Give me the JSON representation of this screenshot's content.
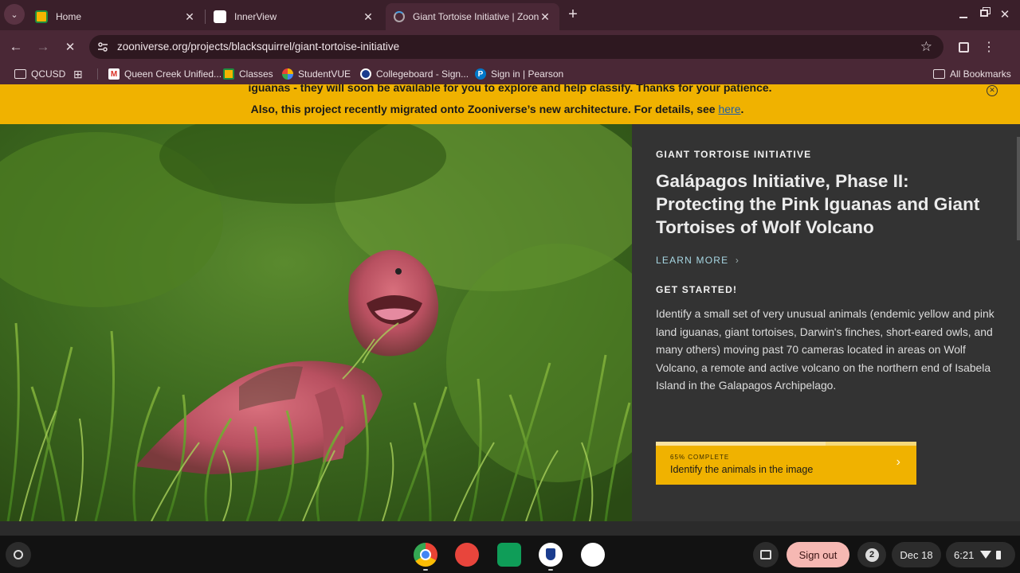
{
  "tabs": [
    {
      "title": "Home",
      "active": false
    },
    {
      "title": "InnerView",
      "active": false
    },
    {
      "title": "Giant Tortoise Initiative | Zooniverse",
      "active": true
    }
  ],
  "toolbar": {
    "url": "zooniverse.org/projects/blacksquirrel/giant-tortoise-initiative"
  },
  "bookmarks": {
    "items": [
      "QCUSD",
      "Queen Creek Unified...",
      "Classes",
      "StudentVUE",
      "Collegeboard - Sign...",
      "Sign in | Pearson"
    ],
    "all_label": "All Bookmarks"
  },
  "banner": {
    "line1": "iguanas - they will soon be available for you to explore and help classify. Thanks for your patience.",
    "line2": "Also, this project recently migrated onto Zooniverse’s new architecture. For details, see ",
    "link": "here",
    "period": "."
  },
  "hero": {
    "kicker": "GIANT TORTOISE INITIATIVE",
    "title": "Galápagos Initiative, Phase II: Protecting the Pink Iguanas and Giant Tortoises of Wolf Volcano",
    "learn_more": "LEARN MORE",
    "get_started": "GET STARTED!",
    "description": "Identify a small set of very unusual animals (endemic yellow and pink land iguanas, giant tortoises, Darwin's finches, short-eared owls, and many others) moving past 70 cameras located in areas on Wolf Volcano, a remote and active volcano on the northern end of Isabela Island in the Galapagos Archipelago.",
    "workflow": {
      "progress_label": "65% COMPLETE",
      "progress": 0.65,
      "label": "Identify the animals in the image"
    }
  },
  "shelf": {
    "sign_out": "Sign out",
    "notifications": "2",
    "date": "Dec 18",
    "time": "6:21"
  },
  "colors": {
    "banner": "#f0b200",
    "panel": "#333333",
    "link": "#a7d7e3"
  }
}
